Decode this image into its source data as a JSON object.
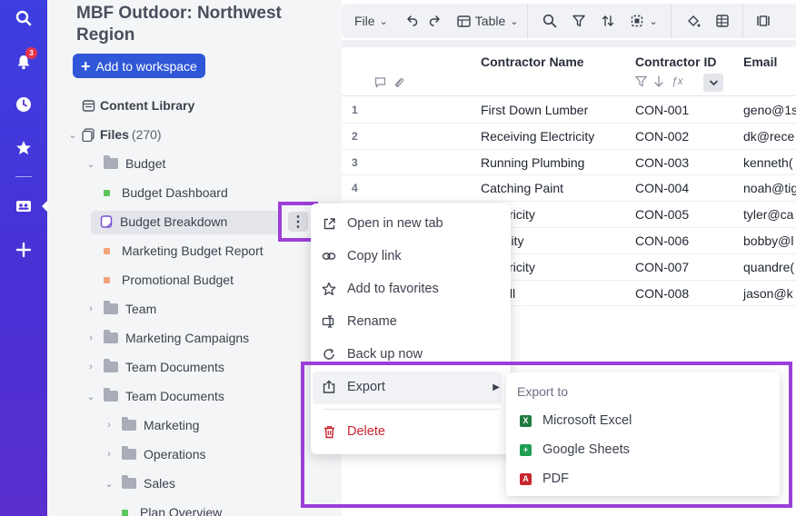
{
  "rail": {
    "notification_count": "3"
  },
  "sidebar": {
    "workspace_title": "MBF Outdoor: Northwest Region",
    "add_button": "Add to workspace",
    "content_library": "Content Library",
    "files_label": "Files",
    "files_count": "(270)",
    "tree": [
      {
        "label": "Budget",
        "type": "folder"
      },
      {
        "label": "Budget Dashboard",
        "type": "file",
        "color": "#5cc65c"
      },
      {
        "label": "Budget Breakdown",
        "type": "file",
        "color": "#7a4fd8"
      },
      {
        "label": "Marketing Budget Report",
        "type": "file",
        "color": "#f3a27a"
      },
      {
        "label": "Promotional Budget",
        "type": "file",
        "color": "#f3a27a"
      },
      {
        "label": "Team",
        "type": "folder"
      },
      {
        "label": "Marketing Campaigns",
        "type": "folder"
      },
      {
        "label": "Team Documents",
        "type": "folder"
      },
      {
        "label": "Team Documents",
        "type": "folder"
      },
      {
        "label": "Marketing",
        "type": "folder"
      },
      {
        "label": "Operations",
        "type": "folder"
      },
      {
        "label": "Sales",
        "type": "folder"
      },
      {
        "label": "Plan Overview",
        "type": "file",
        "color": "#5cc65c"
      }
    ]
  },
  "toolbar": {
    "file_label": "File",
    "table_label": "Table"
  },
  "grid": {
    "columns": [
      "Contractor Name",
      "Contractor ID",
      "Email"
    ],
    "rows": [
      {
        "num": "1",
        "name": "First Down Lumber",
        "id": "CON-001",
        "email": "geno@1s"
      },
      {
        "num": "2",
        "name": "Receiving Electricity",
        "id": "CON-002",
        "email": "dk@rece"
      },
      {
        "num": "3",
        "name": "Running Plumbing",
        "id": "CON-003",
        "email": "kenneth("
      },
      {
        "num": "4",
        "name": "Catching Paint",
        "id": "CON-004",
        "email": "noah@tig"
      },
      {
        "num": "",
        "name": "Electricity",
        "id": "CON-005",
        "email": "tyler@ca"
      },
      {
        "num": "",
        "name": "ectricity",
        "id": "CON-006",
        "email": "bobby@l"
      },
      {
        "num": "",
        "name": "Electricity",
        "id": "CON-007",
        "email": "quandre("
      },
      {
        "num": "",
        "name": "o It All",
        "id": "CON-008",
        "email": "jason@k"
      }
    ]
  },
  "context_menu": {
    "open_new_tab": "Open in new tab",
    "copy_link": "Copy link",
    "add_favorites": "Add to favorites",
    "rename": "Rename",
    "back_up": "Back up now",
    "export": "Export",
    "delete": "Delete"
  },
  "export_menu": {
    "heading": "Export to",
    "excel": "Microsoft Excel",
    "sheets": "Google Sheets",
    "pdf": "PDF"
  },
  "colors": {
    "accent": "#2f57d8",
    "highlight": "#9b3fd8",
    "rail": "#3d3fe0",
    "danger": "#c8252f"
  }
}
